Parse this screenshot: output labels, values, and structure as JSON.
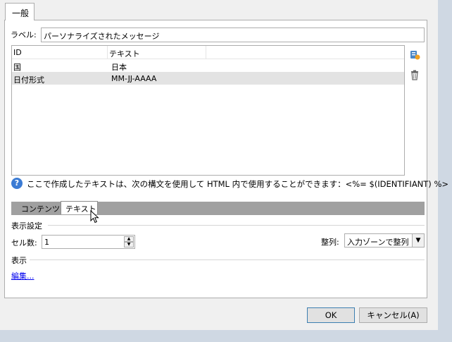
{
  "tabs_top": {
    "general": "一般"
  },
  "label_field": {
    "label": "ラベル:",
    "value": "パーソナライズされたメッセージ"
  },
  "table": {
    "headers": [
      "ID",
      "テキスト"
    ],
    "rows": [
      {
        "id": "国",
        "text": "日本"
      },
      {
        "id": "日付形式",
        "text": "MM-JJ-AAAA"
      }
    ],
    "selected_row": 1
  },
  "side_icons": [
    "add-icon",
    "delete-icon"
  ],
  "info": {
    "icon": "help-icon",
    "text": "ここで作成したテキストは、次の構文を使用して HTML 内で使用することができます：<%= $(IDENTIFIANT) %>"
  },
  "bottom_tabs": [
    "コンテンツ",
    "テキスト"
  ],
  "display_settings": {
    "section": "表示設定",
    "cells_label": "セル数:",
    "cells_value": "1",
    "align_label": "整列:",
    "align_value": "入力ゾーンで整列"
  },
  "display": {
    "section": "表示",
    "edit_link": "編集..."
  },
  "buttons": {
    "ok": "OK",
    "cancel": "キャンセル(A)"
  },
  "colors": {
    "accent": "#3b7bd4",
    "selection": "#e3e3e3",
    "tabbar": "#a0a0a0"
  }
}
